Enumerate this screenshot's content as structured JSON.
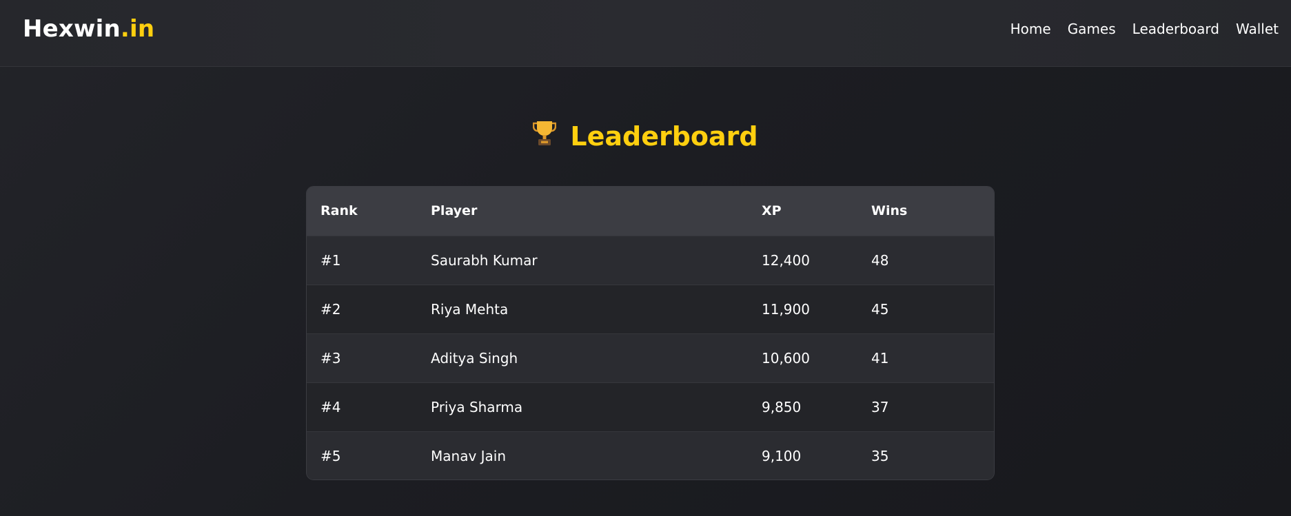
{
  "header": {
    "logo_brand": "Hexwin",
    "logo_tld": ".in",
    "nav": [
      {
        "label": "Home"
      },
      {
        "label": "Games"
      },
      {
        "label": "Leaderboard"
      },
      {
        "label": "Wallet"
      }
    ]
  },
  "main": {
    "title": "Leaderboard",
    "title_icon": "trophy-icon",
    "accent_color": "#ffcf0f",
    "table": {
      "columns": [
        "Rank",
        "Player",
        "XP",
        "Wins"
      ],
      "rows": [
        {
          "rank": "#1",
          "player": "Saurabh Kumar",
          "xp": "12,400",
          "wins": "48"
        },
        {
          "rank": "#2",
          "player": "Riya Mehta",
          "xp": "11,900",
          "wins": "45"
        },
        {
          "rank": "#3",
          "player": "Aditya Singh",
          "xp": "10,600",
          "wins": "41"
        },
        {
          "rank": "#4",
          "player": "Priya Sharma",
          "xp": "9,850",
          "wins": "37"
        },
        {
          "rank": "#5",
          "player": "Manav Jain",
          "xp": "9,100",
          "wins": "35"
        }
      ]
    }
  }
}
